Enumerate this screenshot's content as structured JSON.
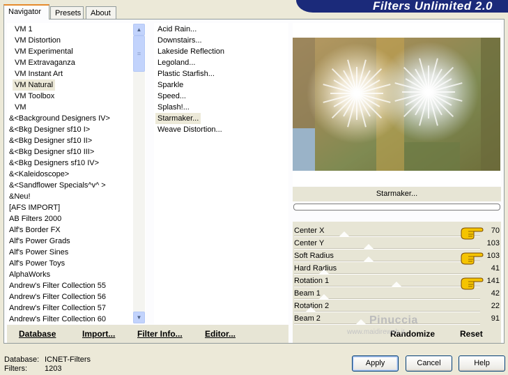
{
  "window": {
    "title": "Filters Unlimited 2.0"
  },
  "tabs": [
    {
      "label": "Navigator",
      "active": true
    },
    {
      "label": "Presets",
      "active": false
    },
    {
      "label": "About",
      "active": false
    }
  ],
  "categories": {
    "items": [
      "VM 1",
      "VM Distortion",
      "VM Experimental",
      "VM Extravaganza",
      "VM Instant Art",
      "VM Natural",
      "VM Toolbox",
      "VM",
      "&<Background Designers IV>",
      "&<Bkg Designer sf10 I>",
      "&<Bkg Designer sf10 II>",
      "&<Bkg Designer sf10 III>",
      "&<Bkg Designers sf10 IV>",
      "&<Kaleidoscope>",
      "&<Sandflower Specials^v^ >",
      "&Neu!",
      "[AFS IMPORT]",
      "AB Filters 2000",
      "Alf's Border FX",
      "Alf's Power Grads",
      "Alf's Power Sines",
      "Alf's Power Toys",
      "AlphaWorks",
      "Andrew's Filter Collection 55",
      "Andrew's Filter Collection 56",
      "Andrew's Filter Collection 57",
      "Andrew's Filter Collection 60"
    ],
    "selected": "VM Natural"
  },
  "filters": {
    "items": [
      "Acid Rain...",
      "Downstairs...",
      "Lakeside Reflection",
      "Legoland...",
      "Plastic Starfish...",
      "Sparkle",
      "Speed...",
      "Splash!...",
      "Starmaker...",
      "Weave Distortion..."
    ],
    "selected": "Starmaker..."
  },
  "preview": {
    "filter_name": "Starmaker..."
  },
  "params": [
    {
      "label": "Center X",
      "value": "70",
      "level": 0.27,
      "hand": true
    },
    {
      "label": "Center Y",
      "value": "103",
      "level": 0.4,
      "hand": false
    },
    {
      "label": "Soft Radius",
      "value": "103",
      "level": 0.4,
      "hand": true
    },
    {
      "label": "Hard Radius",
      "value": "41",
      "level": 0.16,
      "hand": false
    },
    {
      "label": "Rotation 1",
      "value": "141",
      "level": 0.55,
      "hand": true
    },
    {
      "label": "Beam 1",
      "value": "42",
      "level": 0.16,
      "hand": false
    },
    {
      "label": "Rotation 2",
      "value": "22",
      "level": 0.09,
      "hand": false
    },
    {
      "label": "Beam 2",
      "value": "91",
      "level": 0.36,
      "hand": false
    }
  ],
  "toolbar_left": {
    "database": "Database",
    "import": "Import...",
    "filter_info": "Filter Info...",
    "editor": "Editor..."
  },
  "toolbar_right": {
    "randomize": "Randomize",
    "reset": "Reset"
  },
  "watermark": {
    "name": "Pinuccia",
    "site": "www.maidireweb.it"
  },
  "footer": {
    "database_label": "Database:",
    "database_value": "ICNET-Filters",
    "filters_label": "Filters:",
    "filters_value": "1203"
  },
  "buttons": {
    "apply": "Apply",
    "cancel": "Cancel",
    "help": "Help"
  },
  "colors": {
    "banner": "#1b2a7a",
    "panel_face": "#e7e5d5",
    "hand_fill": "#f5c400"
  }
}
